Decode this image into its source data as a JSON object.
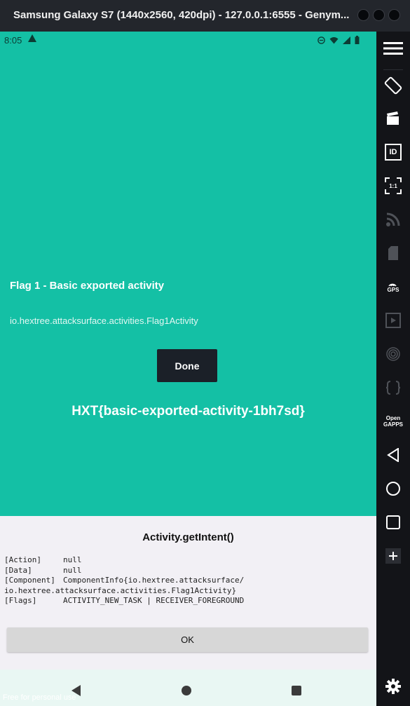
{
  "window": {
    "title": "Samsung Galaxy S7 (1440x2560, 420dpi) - 127.0.0.1:6555 - Genym..."
  },
  "status_bar": {
    "time": "8:05"
  },
  "activity": {
    "flag_title": "Flag 1 - Basic exported activity",
    "activity_name": "io.hextree.attacksurface.activities.Flag1Activity",
    "done_label": "Done",
    "flag_value": "HXT{basic-exported-activity-1bh7sd}"
  },
  "intent_panel": {
    "title": "Activity.getIntent()",
    "rows": [
      {
        "key": "[Action]",
        "value": "null"
      },
      {
        "key": "[Data]",
        "value": "null"
      },
      {
        "key": "[Component]",
        "value": "ComponentInfo{io.hextree.attacksurface/"
      },
      {
        "key": "",
        "value": "io.hextree.attacksurface.activities.Flag1Activity}"
      },
      {
        "key": "[Flags]",
        "value": "ACTIVITY_NEW_TASK | RECEIVER_FOREGROUND"
      }
    ],
    "ok_label": "OK"
  },
  "watermark": "Free for personal use",
  "sidebar": {
    "gps_label": "GPS",
    "opengapps_line1": "Open",
    "opengapps_line2": "GAPPS",
    "pixel_label": "1:1",
    "id_label": "ID",
    "icons": [
      "menu-icon",
      "rotate-icon",
      "capture-icon",
      "identifier-icon",
      "pixel-perfect-icon",
      "cast-icon",
      "storage-icon",
      "gps-icon",
      "media-icon",
      "fingerprint-icon",
      "code-icon",
      "opengapps-icon",
      "back-icon",
      "home-icon",
      "recents-icon",
      "add-icon",
      "settings-icon"
    ]
  },
  "colors": {
    "teal": "#14c0a5",
    "dark_button": "#1b2028",
    "panel_bg": "#f2f0f5"
  }
}
